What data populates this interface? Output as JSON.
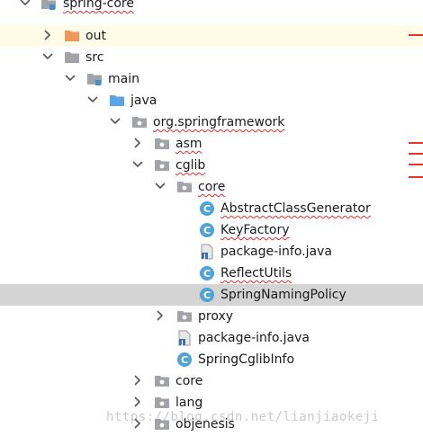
{
  "tree": {
    "rows": [
      {
        "label": "spring-core",
        "icon": "module-folder-icon",
        "open": true,
        "squiggle": true
      },
      {
        "label": "out",
        "icon": "orange-folder-icon",
        "open": false,
        "squiggle": false
      },
      {
        "label": "src",
        "icon": "gray-folder-icon",
        "open": true,
        "squiggle": false
      },
      {
        "label": "main",
        "icon": "gray-folder-icon",
        "open": true,
        "squiggle": false
      },
      {
        "label": "java",
        "icon": "source-folder-icon",
        "open": true,
        "squiggle": false
      },
      {
        "label": "org.springframework",
        "icon": "package-icon",
        "open": true,
        "squiggle": true
      },
      {
        "label": "asm",
        "icon": "package-icon",
        "open": false,
        "squiggle": true
      },
      {
        "label": "cglib",
        "icon": "package-icon",
        "open": true,
        "squiggle": true
      },
      {
        "label": "core",
        "icon": "package-icon",
        "open": true,
        "squiggle": true
      },
      {
        "label": "AbstractClassGenerator",
        "icon": "class-icon",
        "squiggle": true
      },
      {
        "label": "KeyFactory",
        "icon": "class-icon",
        "squiggle": true
      },
      {
        "label": "package-info.java",
        "icon": "java-file-icon",
        "squiggle": false
      },
      {
        "label": "ReflectUtils",
        "icon": "class-icon",
        "squiggle": true
      },
      {
        "label": "SpringNamingPolicy",
        "icon": "class-icon",
        "squiggle": false
      },
      {
        "label": "proxy",
        "icon": "package-icon",
        "open": false,
        "squiggle": false
      },
      {
        "label": "package-info.java",
        "icon": "java-file-icon",
        "squiggle": false
      },
      {
        "label": "SpringCglibInfo",
        "icon": "class-icon",
        "squiggle": false
      },
      {
        "label": "core",
        "icon": "package-icon",
        "open": false,
        "squiggle": false
      },
      {
        "label": "lang",
        "icon": "package-icon",
        "open": false,
        "squiggle": false
      },
      {
        "label": "objenesis",
        "icon": "package-icon",
        "open": false,
        "squiggle": false
      }
    ]
  },
  "watermark": "https://blog.csdn.net/lianjiaokeji",
  "colors": {
    "selection": "#d4d4d4",
    "highlight_row": "#fffbe6",
    "error_mark": "#e8352c",
    "squiggle": "#e03030",
    "class_icon": "#4fa3d9"
  }
}
